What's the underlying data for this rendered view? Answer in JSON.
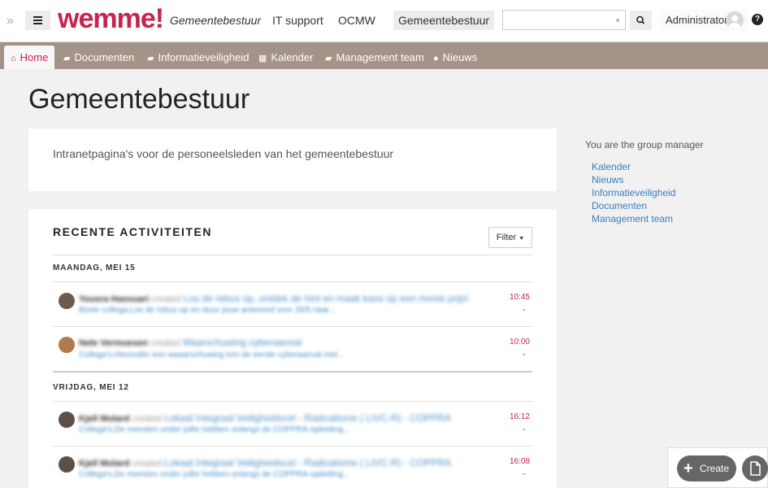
{
  "header": {
    "logo": "wemme!",
    "nav": [
      {
        "label": "Gemeentebestuur"
      },
      {
        "label": "IT support"
      },
      {
        "label": "OCMW"
      },
      {
        "label": "Gemeentebestuur"
      }
    ],
    "search_value": "",
    "user": "Administrator",
    "help_icon": "?"
  },
  "subnav": {
    "tabs": [
      {
        "label": "Home",
        "icon": "home-icon"
      },
      {
        "label": "Documenten",
        "icon": "folder-icon"
      },
      {
        "label": "Informatieveiligheid",
        "icon": "folder-icon"
      },
      {
        "label": "Kalender",
        "icon": "calendar-icon"
      },
      {
        "label": "Management team",
        "icon": "folder-icon"
      },
      {
        "label": "Nieuws",
        "icon": "comments-icon"
      }
    ]
  },
  "main": {
    "title": "Gemeentebestuur",
    "intro": "Intranetpagina's voor de personeelsleden van het gemeentebestuur",
    "activity": {
      "title": "RECENTE ACTIVITEITEN",
      "filter_label": "Filter",
      "groups": [
        {
          "date": "MAANDAG, MEI 15",
          "items": [
            {
              "who": "Yousra Hassuari",
              "verb": "created",
              "what": "Los de rebus op, ontdek de hint en maak kans op een mooie prijs!",
              "excerpt": "Beste collega,Los de rebus op en stuur jouw antwoord voor 29/5 naar...",
              "time": "10:45"
            },
            {
              "who": "Nele Vermoesen",
              "verb": "created",
              "what": "Waarschuwing cyberaanval",
              "excerpt": "Collega's,Hieronder een waaarschuwing tvm de eerste cyberaanval met...",
              "time": "10:00"
            }
          ]
        },
        {
          "date": "VRIJDAG, MEI 12",
          "items": [
            {
              "who": "Kjell Molard",
              "verb": "created",
              "what": "Lokaal Integraal Veiligheidscel - Radicalisme ( LIVC-R) - COPPRA",
              "excerpt": "Collega's,De meesten onder jullie hebben onlangs de COPPRA-opleiding...",
              "time": "16:12"
            },
            {
              "who": "Kjell Molard",
              "verb": "created",
              "what": "Lokaal Integraal Veiligheidscel - Radicalisme ( LIVC-R) - COPPRA",
              "excerpt": "Collega's,De meesten onder jullie hebben onlangs de COPPRA-opleiding...",
              "time": "16:08"
            }
          ]
        }
      ]
    }
  },
  "sidebar": {
    "note": "You are the group manager",
    "links": [
      {
        "label": "Kalender"
      },
      {
        "label": "Nieuws"
      },
      {
        "label": "Informatieveiligheid"
      },
      {
        "label": "Documenten"
      },
      {
        "label": "Management team"
      }
    ]
  },
  "create": {
    "label": "Create"
  },
  "colors": {
    "brand": "#c8234f",
    "subnav": "#a49389",
    "link": "#3a7cbf"
  }
}
